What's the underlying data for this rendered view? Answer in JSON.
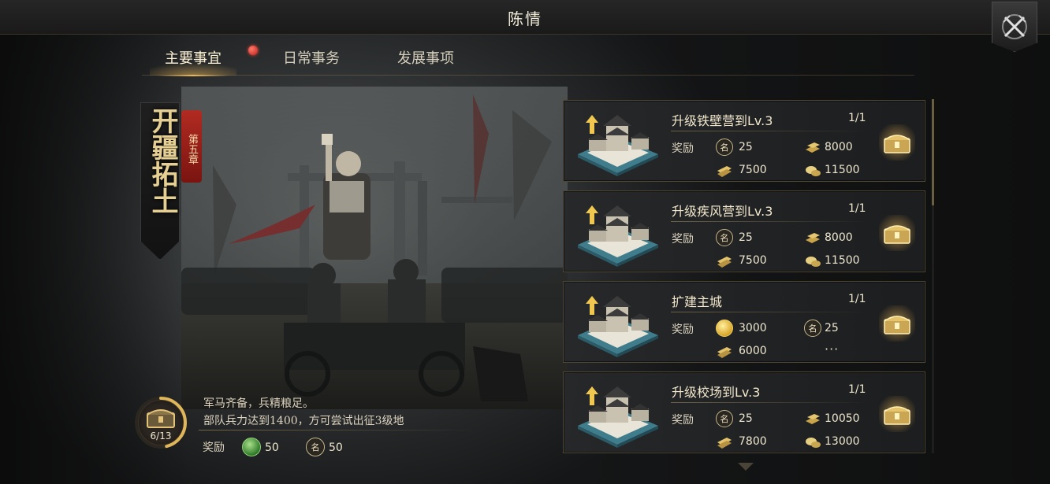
{
  "window": {
    "title": "陈情"
  },
  "tabs": [
    {
      "label": "主要事宜",
      "active": true,
      "has_notification": true
    },
    {
      "label": "日常事务",
      "active": false
    },
    {
      "label": "发展事项",
      "active": false
    }
  ],
  "chapter": {
    "title": "开疆拓土",
    "tag": "第五章"
  },
  "main_quest": {
    "progress": "6/13",
    "progress_fraction": 0.4615,
    "description_lines": [
      "军马齐备，兵精粮足。",
      "部队兵力达到1400，方可尝试出征3级地"
    ],
    "reward_label": "奖励",
    "rewards": [
      {
        "icon": "jade-icon",
        "value": "50"
      },
      {
        "icon": "fame-icon",
        "value": "50"
      }
    ]
  },
  "quests": [
    {
      "title": "升级铁壁营到Lv.3",
      "progress": "1/1",
      "reward_label": "奖励",
      "rewards": [
        {
          "icon": "fame-icon",
          "value": "25"
        },
        {
          "icon": "iron-icon",
          "value": "8000"
        },
        {
          "icon": "wood-icon",
          "value": "7500"
        },
        {
          "icon": "grain-icon",
          "value": "11500"
        }
      ]
    },
    {
      "title": "升级疾风营到Lv.3",
      "progress": "1/1",
      "reward_label": "奖励",
      "rewards": [
        {
          "icon": "fame-icon",
          "value": "25"
        },
        {
          "icon": "iron-icon",
          "value": "8000"
        },
        {
          "icon": "wood-icon",
          "value": "7500"
        },
        {
          "icon": "grain-icon",
          "value": "11500"
        }
      ]
    },
    {
      "title": "扩建主城",
      "progress": "1/1",
      "reward_label": "奖励",
      "rewards": [
        {
          "icon": "coin-icon",
          "value": "3000"
        },
        {
          "icon": "fame-icon",
          "value": "25"
        },
        {
          "icon": "wood-icon",
          "value": "6000"
        },
        {
          "icon": "more-icon",
          "value": "···"
        }
      ]
    },
    {
      "title": "升级校场到Lv.3",
      "progress": "1/1",
      "reward_label": "奖励",
      "rewards": [
        {
          "icon": "fame-icon",
          "value": "25"
        },
        {
          "icon": "iron-icon",
          "value": "10050"
        },
        {
          "icon": "wood-icon",
          "value": "7800"
        },
        {
          "icon": "grain-icon",
          "value": "13000"
        }
      ]
    }
  ],
  "icon_glyphs": {
    "fame": "名"
  },
  "colors": {
    "accent_gold": "#e8b860",
    "notification_red": "#c0201a",
    "chapter_red": "#b12b22"
  }
}
